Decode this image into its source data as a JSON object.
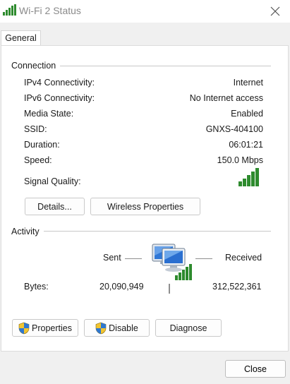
{
  "window": {
    "title": "Wi-Fi 2 Status",
    "title_icon": "wifi-signal-icon",
    "close_icon": "close-icon"
  },
  "tabs": [
    {
      "label": "General",
      "selected": true
    }
  ],
  "connection": {
    "group_label": "Connection",
    "rows": [
      {
        "label": "IPv4 Connectivity:",
        "value": "Internet"
      },
      {
        "label": "IPv6 Connectivity:",
        "value": "No Internet access"
      },
      {
        "label": "Media State:",
        "value": "Enabled"
      },
      {
        "label": "SSID:",
        "value": "GNXS-404100"
      },
      {
        "label": "Duration:",
        "value": "06:01:21"
      },
      {
        "label": "Speed:",
        "value": "150.0 Mbps"
      }
    ],
    "signal_label": "Signal Quality:",
    "signal_bars": 5,
    "signal_color": "#2e8b2e",
    "details_button": "Details...",
    "wireless_properties_button": "Wireless Properties"
  },
  "activity": {
    "group_label": "Activity",
    "sent_label": "Sent",
    "received_label": "Received",
    "bytes_label": "Bytes:",
    "bytes_sent": "20,090,949",
    "bytes_received": "312,522,361"
  },
  "actions": {
    "properties_button": "Properties",
    "disable_button": "Disable",
    "diagnose_button": "Diagnose"
  },
  "footer": {
    "close_button": "Close"
  }
}
